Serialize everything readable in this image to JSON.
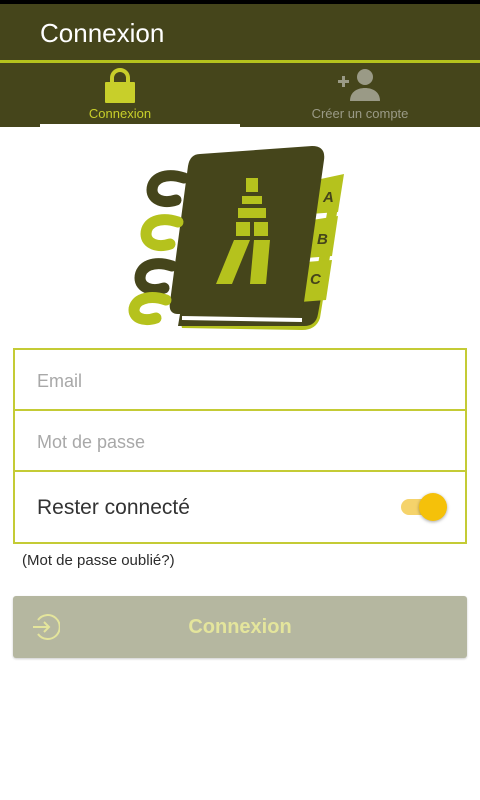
{
  "appbar": {
    "title": "Connexion"
  },
  "tabs": [
    {
      "label": "Connexion",
      "icon": "lock-icon"
    },
    {
      "label": "Créer un compte",
      "icon": "add-user-icon"
    }
  ],
  "form": {
    "email_placeholder": "Email",
    "password_placeholder": "Mot de passe",
    "remember_label": "Rester connecté",
    "remember_on": true,
    "forgot_password": "(Mot de passe oublié?)"
  },
  "login_button": {
    "label": "Connexion",
    "icon": "login-icon"
  },
  "logo": {
    "tabs": [
      "A",
      "B",
      "C"
    ]
  },
  "colors": {
    "primary_dark": "#45451b",
    "accent": "#b5c21d",
    "button_bg": "#b5b7a0",
    "button_text": "#e4e59c",
    "switch_on": "#f5c10a"
  }
}
